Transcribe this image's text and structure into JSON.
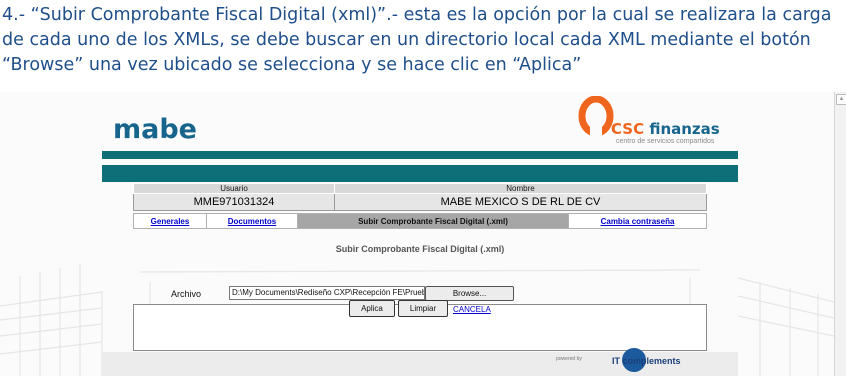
{
  "instruction": {
    "text": "4.- “Subir Comprobante Fiscal Digital (xml)”.- esta es la opción por la cual se realizara la carga de cada uno de los XMLs, se debe buscar en un directorio local cada XML mediante el botón “Browse” una vez ubicado se selecciona y se hace clic en “Aplica”"
  },
  "brand": {
    "mabe": "mabe",
    "csc_prefix": "CSC",
    "csc_suffix": " finanzas",
    "csc_subtitle": "centro de servicios compartidos",
    "accent": "#0f6f78",
    "orange": "#f0651e",
    "blue": "#17658c"
  },
  "user": {
    "usuario_label": "Usuario",
    "nombre_label": "Nombre",
    "usuario_value": "MME971031324",
    "nombre_value": "MABE MEXICO S DE RL DE CV"
  },
  "tabs": {
    "generales": "Generales",
    "documentos": "Documentos",
    "subir": "Subir Comprobante Fiscal Digital (.xml)",
    "cambia": "Cambia contraseña"
  },
  "form": {
    "title": "Subir Comprobante Fiscal Digital (.xml)",
    "archivo_label": "Archivo",
    "file_value": "D:\\My Documents\\Rediseño CXP\\Recepción FE\\Pruebas\\P",
    "browse_label": "Browse...",
    "aplica_label": "Aplica",
    "limpiar_label": "Limpiar",
    "cancela_label": "CANCELA"
  },
  "footer": {
    "powered": "powered by",
    "itc": "IT complements"
  },
  "icons": {
    "scroll_up": "scroll-up-arrow-icon"
  }
}
